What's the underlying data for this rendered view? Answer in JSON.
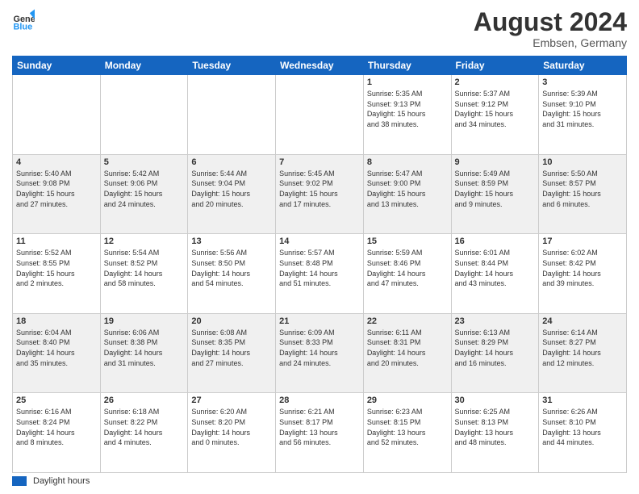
{
  "header": {
    "logo": {
      "line1": "General",
      "line2": "Blue"
    },
    "title": "August 2024",
    "location": "Embsen, Germany"
  },
  "calendar": {
    "weekdays": [
      "Sunday",
      "Monday",
      "Tuesday",
      "Wednesday",
      "Thursday",
      "Friday",
      "Saturday"
    ],
    "weeks": [
      {
        "row": 0,
        "days": [
          {
            "date": "",
            "info": ""
          },
          {
            "date": "",
            "info": ""
          },
          {
            "date": "",
            "info": ""
          },
          {
            "date": "",
            "info": ""
          },
          {
            "date": "1",
            "info": "Sunrise: 5:35 AM\nSunset: 9:13 PM\nDaylight: 15 hours\nand 38 minutes."
          },
          {
            "date": "2",
            "info": "Sunrise: 5:37 AM\nSunset: 9:12 PM\nDaylight: 15 hours\nand 34 minutes."
          },
          {
            "date": "3",
            "info": "Sunrise: 5:39 AM\nSunset: 9:10 PM\nDaylight: 15 hours\nand 31 minutes."
          }
        ]
      },
      {
        "row": 1,
        "days": [
          {
            "date": "4",
            "info": "Sunrise: 5:40 AM\nSunset: 9:08 PM\nDaylight: 15 hours\nand 27 minutes."
          },
          {
            "date": "5",
            "info": "Sunrise: 5:42 AM\nSunset: 9:06 PM\nDaylight: 15 hours\nand 24 minutes."
          },
          {
            "date": "6",
            "info": "Sunrise: 5:44 AM\nSunset: 9:04 PM\nDaylight: 15 hours\nand 20 minutes."
          },
          {
            "date": "7",
            "info": "Sunrise: 5:45 AM\nSunset: 9:02 PM\nDaylight: 15 hours\nand 17 minutes."
          },
          {
            "date": "8",
            "info": "Sunrise: 5:47 AM\nSunset: 9:00 PM\nDaylight: 15 hours\nand 13 minutes."
          },
          {
            "date": "9",
            "info": "Sunrise: 5:49 AM\nSunset: 8:59 PM\nDaylight: 15 hours\nand 9 minutes."
          },
          {
            "date": "10",
            "info": "Sunrise: 5:50 AM\nSunset: 8:57 PM\nDaylight: 15 hours\nand 6 minutes."
          }
        ]
      },
      {
        "row": 0,
        "days": [
          {
            "date": "11",
            "info": "Sunrise: 5:52 AM\nSunset: 8:55 PM\nDaylight: 15 hours\nand 2 minutes."
          },
          {
            "date": "12",
            "info": "Sunrise: 5:54 AM\nSunset: 8:52 PM\nDaylight: 14 hours\nand 58 minutes."
          },
          {
            "date": "13",
            "info": "Sunrise: 5:56 AM\nSunset: 8:50 PM\nDaylight: 14 hours\nand 54 minutes."
          },
          {
            "date": "14",
            "info": "Sunrise: 5:57 AM\nSunset: 8:48 PM\nDaylight: 14 hours\nand 51 minutes."
          },
          {
            "date": "15",
            "info": "Sunrise: 5:59 AM\nSunset: 8:46 PM\nDaylight: 14 hours\nand 47 minutes."
          },
          {
            "date": "16",
            "info": "Sunrise: 6:01 AM\nSunset: 8:44 PM\nDaylight: 14 hours\nand 43 minutes."
          },
          {
            "date": "17",
            "info": "Sunrise: 6:02 AM\nSunset: 8:42 PM\nDaylight: 14 hours\nand 39 minutes."
          }
        ]
      },
      {
        "row": 1,
        "days": [
          {
            "date": "18",
            "info": "Sunrise: 6:04 AM\nSunset: 8:40 PM\nDaylight: 14 hours\nand 35 minutes."
          },
          {
            "date": "19",
            "info": "Sunrise: 6:06 AM\nSunset: 8:38 PM\nDaylight: 14 hours\nand 31 minutes."
          },
          {
            "date": "20",
            "info": "Sunrise: 6:08 AM\nSunset: 8:35 PM\nDaylight: 14 hours\nand 27 minutes."
          },
          {
            "date": "21",
            "info": "Sunrise: 6:09 AM\nSunset: 8:33 PM\nDaylight: 14 hours\nand 24 minutes."
          },
          {
            "date": "22",
            "info": "Sunrise: 6:11 AM\nSunset: 8:31 PM\nDaylight: 14 hours\nand 20 minutes."
          },
          {
            "date": "23",
            "info": "Sunrise: 6:13 AM\nSunset: 8:29 PM\nDaylight: 14 hours\nand 16 minutes."
          },
          {
            "date": "24",
            "info": "Sunrise: 6:14 AM\nSunset: 8:27 PM\nDaylight: 14 hours\nand 12 minutes."
          }
        ]
      },
      {
        "row": 0,
        "days": [
          {
            "date": "25",
            "info": "Sunrise: 6:16 AM\nSunset: 8:24 PM\nDaylight: 14 hours\nand 8 minutes."
          },
          {
            "date": "26",
            "info": "Sunrise: 6:18 AM\nSunset: 8:22 PM\nDaylight: 14 hours\nand 4 minutes."
          },
          {
            "date": "27",
            "info": "Sunrise: 6:20 AM\nSunset: 8:20 PM\nDaylight: 14 hours\nand 0 minutes."
          },
          {
            "date": "28",
            "info": "Sunrise: 6:21 AM\nSunset: 8:17 PM\nDaylight: 13 hours\nand 56 minutes."
          },
          {
            "date": "29",
            "info": "Sunrise: 6:23 AM\nSunset: 8:15 PM\nDaylight: 13 hours\nand 52 minutes."
          },
          {
            "date": "30",
            "info": "Sunrise: 6:25 AM\nSunset: 8:13 PM\nDaylight: 13 hours\nand 48 minutes."
          },
          {
            "date": "31",
            "info": "Sunrise: 6:26 AM\nSunset: 8:10 PM\nDaylight: 13 hours\nand 44 minutes."
          }
        ]
      }
    ]
  },
  "footer": {
    "legend_label": "Daylight hours"
  }
}
